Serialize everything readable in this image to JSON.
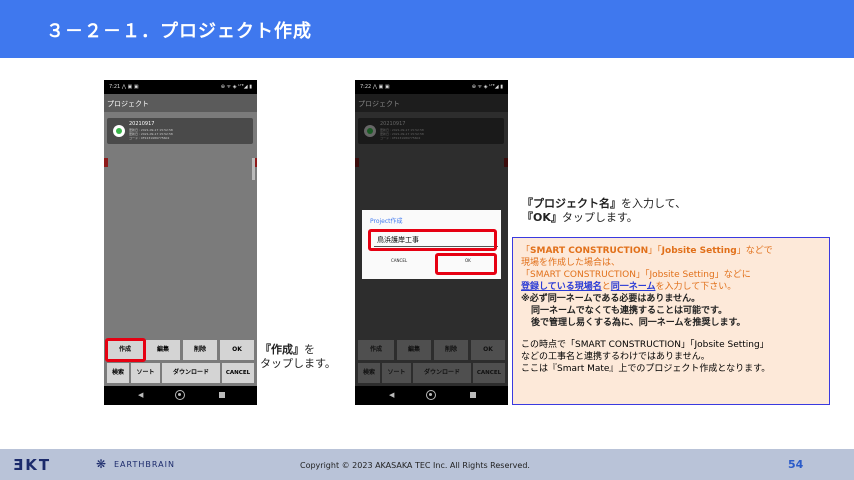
{
  "header": {
    "title": "３－２－１．プロジェクト作成"
  },
  "phone_left": {
    "status_time": "7:21",
    "status_icons_left": "⋀ ▣ ▣",
    "status_icons_right": "⊕ ᯤ ◈ ᴸᵀᴱ◢ ▮",
    "app_title": "プロジェクト",
    "project": {
      "name": "20210917",
      "meta1": "更新日 : 2021-09-17 15:52:58",
      "meta2": "更新日 : 2021-09-17 15:52:58",
      "meta3": "コード : 0F2231989775602"
    },
    "buttons_row1": [
      "作成",
      "編集",
      "削除",
      "OK"
    ],
    "buttons_row2": [
      "検索",
      "ソート",
      "ダウンロード",
      "CANCEL"
    ]
  },
  "phone_right": {
    "status_time": "7:22",
    "status_icons_left": "⋀ ▣ ▣",
    "status_icons_right": "⊕ ᯤ ◈ ᴸᵀᴱ◢ ▮",
    "app_title": "プロジェクト",
    "project": {
      "name": "20210917",
      "meta1": "更新日 : 2021-09-17 15:52:58",
      "meta2": "更新日 : 2021-09-17 15:52:58",
      "meta3": "コード : 0F2231989775602"
    },
    "dialog": {
      "title": "Project作成",
      "input_value": "鳥浜護岸工事",
      "cancel_label": "CANCEL",
      "ok_label": "OK"
    },
    "buttons_row1": [
      "作成",
      "編集",
      "削除",
      "OK"
    ],
    "buttons_row2": [
      "検索",
      "ソート",
      "ダウンロード",
      "CANCEL"
    ]
  },
  "caption_left": {
    "bold": "『作成』",
    "rest1": "を",
    "line2": "タップします。"
  },
  "caption_right": {
    "bold1": "『プロジェクト名』",
    "rest1": "を入力して、",
    "bold2": "『OK』",
    "rest2": "タップします。"
  },
  "info": {
    "l1_a": "「",
    "l1_b": "SMART CONSTRUCTION",
    "l1_c": "」「",
    "l1_d": "Jobsite Setting",
    "l1_e": "」などで",
    "l2": "現場を作成した場合は、",
    "l3": "「SMART CONSTRUCTION」「Jobsite Setting」などに",
    "l4_a": "登録している現場名",
    "l4_b": "と",
    "l4_c": "同一ネーム",
    "l4_d": "を入力して下さい。",
    "n1": "※必ず同一ネームである必要はありません。",
    "n2": "同一ネームでなくても連携することは可能です。",
    "n3": "後で管理し易くする為に、同一ネームを推奨します。",
    "p1": "この時点で「SMART CONSTRUCTION」「Jobsite Setting」",
    "p2": "などの工事名と連携するわけではありません。",
    "p3": "ここは『Smart Mate』上でのプロジェクト作成となります。"
  },
  "footer": {
    "logo_akt": "ƎKT",
    "logo_eb": "EARTHBRAIN",
    "copyright": "Copyright © 2023 AKASAKA TEC Inc. All Rights Reserved.",
    "page": "54"
  },
  "colors": {
    "header_bg": "#3f78ee",
    "highlight_red": "#e60012",
    "info_bg": "#fde9d9",
    "info_border": "#3a3ae0",
    "accent_orange": "#e1701a",
    "link_blue": "#2b3bd6",
    "footer_bg": "#b9c3d8"
  }
}
